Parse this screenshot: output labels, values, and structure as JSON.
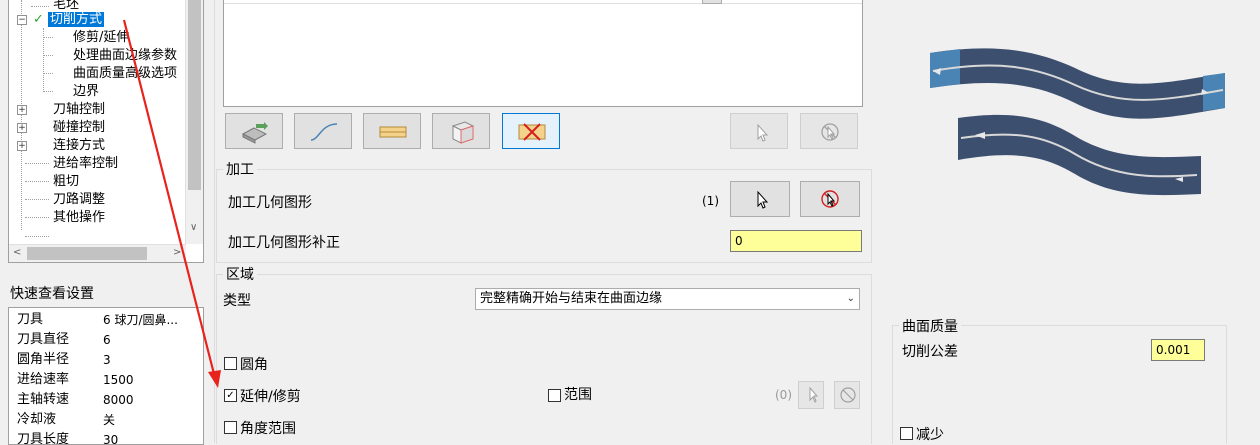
{
  "tree": {
    "items": [
      {
        "label": "毛坯",
        "level": 1
      },
      {
        "label": "切削方式",
        "level": 0,
        "selected": true,
        "checked": true,
        "expanded": true
      },
      {
        "label": "修剪/延伸",
        "level": 1
      },
      {
        "label": "处理曲面边缘参数",
        "level": 1
      },
      {
        "label": "曲面质量高级选项",
        "level": 1
      },
      {
        "label": "边界",
        "level": 1
      },
      {
        "label": "刀轴控制",
        "level": 0,
        "expandable": true
      },
      {
        "label": "碰撞控制",
        "level": 0,
        "expandable": true
      },
      {
        "label": "连接方式",
        "level": 0,
        "expandable": true
      },
      {
        "label": "进给率控制",
        "level": 0
      },
      {
        "label": "粗切",
        "level": 0
      },
      {
        "label": "刀路调整",
        "level": 0
      },
      {
        "label": "其他操作",
        "level": 0
      }
    ]
  },
  "quick_view": {
    "title": "快速查看设置",
    "rows": [
      {
        "key": "刀具",
        "value": "6 球刀/圆鼻..."
      },
      {
        "key": "刀具直径",
        "value": "6"
      },
      {
        "key": "圆角半径",
        "value": "3"
      },
      {
        "key": "进给速率",
        "value": "1500"
      },
      {
        "key": "主轴转速",
        "value": "8000"
      },
      {
        "key": "冷却液",
        "value": "关"
      },
      {
        "key": "刀具长度",
        "value": "30"
      }
    ]
  },
  "machining": {
    "title": "加工",
    "geometry_label": "加工几何图形",
    "geometry_count": "(1)",
    "offset_label": "加工几何图形补正",
    "offset_value": "0"
  },
  "region": {
    "title": "区域",
    "type_label": "类型",
    "type_value": "完整精确开始与结束在曲面边缘",
    "fillet_label": "圆角",
    "extend_label": "延伸/修剪",
    "range_label": "范围",
    "range_count": "(0)",
    "angle_label": "角度范围"
  },
  "surface_quality": {
    "title": "曲面质量",
    "tolerance_label": "切削公差",
    "tolerance_value": "0.001",
    "reduce_label": "减少"
  },
  "colors": {
    "preview_path": "#3d4f6e",
    "preview_end": "#4a84b5",
    "selection": "#0078d7",
    "annotation_arrow": "#e8231e"
  }
}
